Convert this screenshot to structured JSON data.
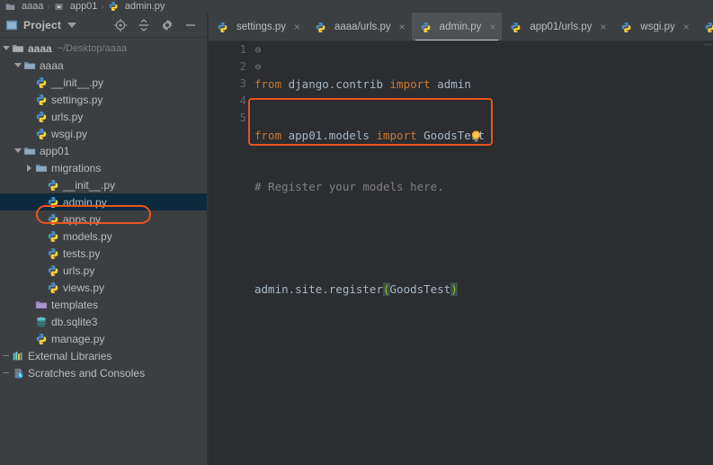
{
  "window": {
    "ide": "PyCharm",
    "theme_bg_sidebar": "#3c3f41",
    "theme_bg_editor": "#2b2d30",
    "accent_highlight": "#e8551f",
    "selection_bg": "#0d293e"
  },
  "breadcrumb": {
    "items": [
      {
        "label": "aaaa",
        "icon": "folder-icon"
      },
      {
        "label": "app01",
        "icon": "module-icon"
      },
      {
        "label": "admin.py",
        "icon": "python-file-icon"
      }
    ],
    "separator": "›"
  },
  "sidebar": {
    "title": "Project",
    "dropdown_icon": "chevron-down-icon",
    "view_icon": "project-view-icon",
    "tools": [
      {
        "name": "locate-icon",
        "title": "Select Opened File"
      },
      {
        "name": "collapse-all-icon",
        "title": "Collapse All"
      },
      {
        "name": "gear-icon",
        "title": "Settings"
      },
      {
        "name": "minimize-icon",
        "title": "Hide"
      }
    ],
    "tree": [
      {
        "label": "aaaa",
        "secondary": "~/Desktop/aaaa",
        "icon": "project-root-icon",
        "indent": 0,
        "twisty": "down",
        "bold": true,
        "selected": false
      },
      {
        "label": "aaaa",
        "secondary": "",
        "icon": "folder-blue-icon",
        "indent": 1,
        "twisty": "down",
        "bold": false,
        "selected": false
      },
      {
        "label": "__init__.py",
        "secondary": "",
        "icon": "python-file-icon",
        "indent": 2,
        "twisty": "none",
        "bold": false,
        "selected": false
      },
      {
        "label": "settings.py",
        "secondary": "",
        "icon": "python-file-icon",
        "indent": 2,
        "twisty": "none",
        "bold": false,
        "selected": false
      },
      {
        "label": "urls.py",
        "secondary": "",
        "icon": "python-file-icon",
        "indent": 2,
        "twisty": "none",
        "bold": false,
        "selected": false
      },
      {
        "label": "wsgi.py",
        "secondary": "",
        "icon": "python-file-icon",
        "indent": 2,
        "twisty": "none",
        "bold": false,
        "selected": false
      },
      {
        "label": "app01",
        "secondary": "",
        "icon": "folder-blue-icon",
        "indent": 1,
        "twisty": "down",
        "bold": false,
        "selected": false
      },
      {
        "label": "migrations",
        "secondary": "",
        "icon": "folder-blue-icon",
        "indent": 2,
        "twisty": "right",
        "bold": false,
        "selected": false
      },
      {
        "label": "__init__.py",
        "secondary": "",
        "icon": "python-file-icon",
        "indent": 3,
        "twisty": "none",
        "bold": false,
        "selected": false
      },
      {
        "label": "admin.py",
        "secondary": "",
        "icon": "python-file-icon",
        "indent": 3,
        "twisty": "none",
        "bold": false,
        "selected": true
      },
      {
        "label": "apps.py",
        "secondary": "",
        "icon": "python-file-icon",
        "indent": 3,
        "twisty": "none",
        "bold": false,
        "selected": false
      },
      {
        "label": "models.py",
        "secondary": "",
        "icon": "python-file-icon",
        "indent": 3,
        "twisty": "none",
        "bold": false,
        "selected": false
      },
      {
        "label": "tests.py",
        "secondary": "",
        "icon": "python-file-icon",
        "indent": 3,
        "twisty": "none",
        "bold": false,
        "selected": false
      },
      {
        "label": "urls.py",
        "secondary": "",
        "icon": "python-file-icon",
        "indent": 3,
        "twisty": "none",
        "bold": false,
        "selected": false
      },
      {
        "label": "views.py",
        "secondary": "",
        "icon": "python-file-icon",
        "indent": 3,
        "twisty": "none",
        "bold": false,
        "selected": false
      },
      {
        "label": "templates",
        "secondary": "",
        "icon": "folder-purple-icon",
        "indent": 2,
        "twisty": "none",
        "bold": false,
        "selected": false
      },
      {
        "label": "db.sqlite3",
        "secondary": "",
        "icon": "database-icon",
        "indent": 2,
        "twisty": "none",
        "bold": false,
        "selected": false
      },
      {
        "label": "manage.py",
        "secondary": "",
        "icon": "python-file-icon",
        "indent": 2,
        "twisty": "none",
        "bold": false,
        "selected": false
      },
      {
        "label": "External Libraries",
        "secondary": "",
        "icon": "library-icon",
        "indent": 0,
        "twisty": "dash",
        "bold": false,
        "selected": false
      },
      {
        "label": "Scratches and Consoles",
        "secondary": "",
        "icon": "scratches-icon",
        "indent": 0,
        "twisty": "dash",
        "bold": false,
        "selected": false
      }
    ]
  },
  "editor": {
    "tabs": [
      {
        "label": "settings.py",
        "icon": "python-file-icon",
        "active": false,
        "close_icon": "close-icon"
      },
      {
        "label": "aaaa/urls.py",
        "icon": "python-file-icon",
        "active": false,
        "close_icon": "close-icon"
      },
      {
        "label": "admin.py",
        "icon": "python-file-icon",
        "active": true,
        "close_icon": "close-icon"
      },
      {
        "label": "app01/urls.py",
        "icon": "python-file-icon",
        "active": false,
        "close_icon": "close-icon"
      },
      {
        "label": "wsgi.py",
        "icon": "python-file-icon",
        "active": false,
        "close_icon": "close-icon"
      },
      {
        "label": "",
        "icon": "python-file-icon",
        "active": false,
        "close_icon": "close-icon"
      }
    ],
    "line_numbers": [
      "1",
      "2",
      "3",
      "4",
      "5"
    ],
    "fold_markers": [
      "⊖",
      "⊖",
      "",
      "",
      ""
    ],
    "intention_bulb": "lightbulb-icon",
    "code": {
      "line1": {
        "kw1": "from",
        "mid": " django.contrib ",
        "kw2": "import",
        "tail": " admin"
      },
      "line2": {
        "kw1": "from",
        "mid": " app01.models ",
        "kw2": "import",
        "tail": " GoodsTest"
      },
      "line3": {
        "comment": "# Register your models here."
      },
      "line4": {
        "text": ""
      },
      "line5": {
        "pre": "admin.site.register",
        "open": "(",
        "arg": "GoodsTest",
        "close": ")"
      }
    },
    "highlight_box_label": "highlighted-code-region"
  }
}
